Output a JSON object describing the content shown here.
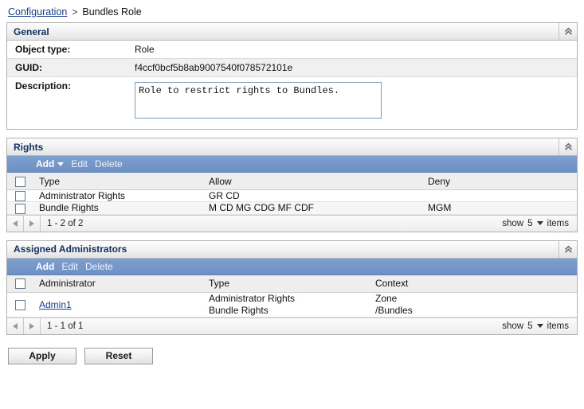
{
  "breadcrumb": {
    "parent": "Configuration",
    "separator": ">",
    "current": "Bundles Role"
  },
  "general": {
    "title": "General",
    "collapse_icon": "double-chevron-up-icon",
    "rows": [
      {
        "label": "Object type:",
        "value": "Role"
      },
      {
        "label": "GUID:",
        "value": "f4ccf0bcf5b8ab9007540f078572101e"
      }
    ],
    "description_label": "Description:",
    "description_value": "Role to restrict rights to Bundles.",
    "description_placeholder": ""
  },
  "rights": {
    "title": "Rights",
    "collapse_icon": "double-chevron-up-icon",
    "toolbar": {
      "add": "Add",
      "add_caret": "caret-down-icon",
      "edit": "Edit",
      "delete": "Delete"
    },
    "columns": [
      "Type",
      "Allow",
      "Deny"
    ],
    "rows": [
      {
        "type": "Administrator Rights",
        "allow": "GR CD",
        "deny": ""
      },
      {
        "type": "Bundle Rights",
        "allow": "M CD MG CDG MF CDF",
        "deny": "MGM"
      }
    ],
    "pager": {
      "prev_icon": "triangle-left-icon",
      "next_icon": "triangle-right-icon",
      "range": "1 - 2 of 2",
      "show_label": "show",
      "page_size": "5",
      "items_label": "items"
    }
  },
  "assigned_administrators": {
    "title": "Assigned Administrators",
    "collapse_icon": "double-chevron-up-icon",
    "toolbar": {
      "add": "Add",
      "edit": "Edit",
      "delete": "Delete"
    },
    "columns": [
      "Administrator",
      "Type",
      "Context"
    ],
    "rows": [
      {
        "administrator": "Admin1",
        "type": "Administrator Rights\nBundle Rights",
        "context": "Zone\n/Bundles"
      }
    ],
    "pager": {
      "prev_icon": "triangle-left-icon",
      "next_icon": "triangle-right-icon",
      "range": "1 - 1 of 1",
      "show_label": "show",
      "page_size": "5",
      "items_label": "items"
    }
  },
  "footer": {
    "apply": "Apply",
    "reset": "Reset"
  },
  "colors": {
    "toolbar_blue": "#6d8fc3",
    "link_blue": "#1a3c8c",
    "header_text": "#123060",
    "panel_border": "#b0b0b0",
    "zebra_row": "#f6f6f6",
    "alt_row": "#f0f0f0"
  }
}
